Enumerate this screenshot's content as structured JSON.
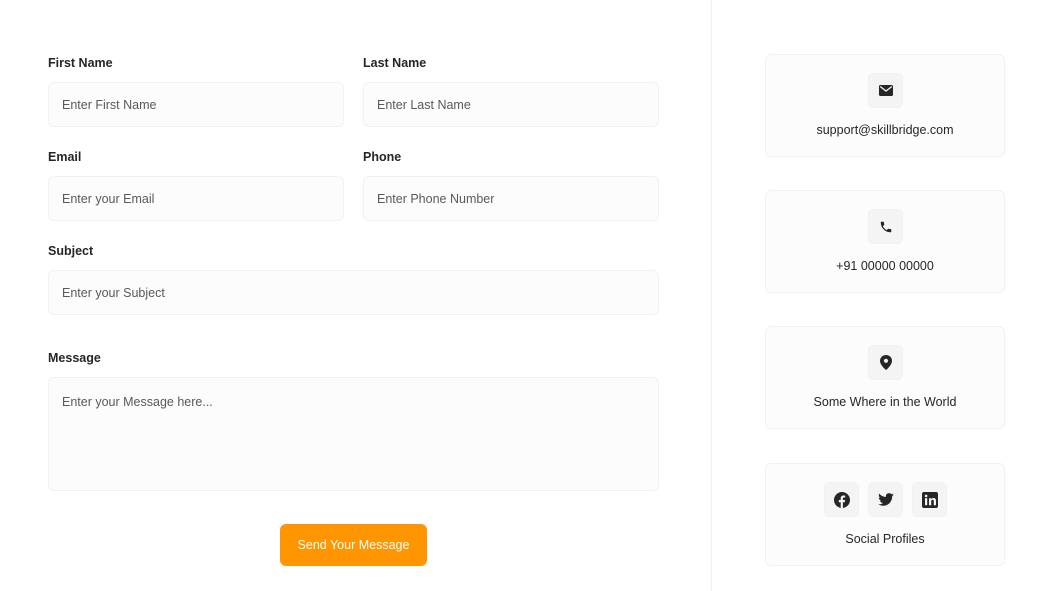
{
  "form": {
    "first_name": {
      "label": "First Name",
      "placeholder": "Enter First Name"
    },
    "last_name": {
      "label": "Last Name",
      "placeholder": "Enter Last Name"
    },
    "email": {
      "label": "Email",
      "placeholder": "Enter your Email"
    },
    "phone": {
      "label": "Phone",
      "placeholder": "Enter Phone Number"
    },
    "subject": {
      "label": "Subject",
      "placeholder": "Enter your Subject"
    },
    "message": {
      "label": "Message",
      "placeholder": "Enter your Message here..."
    },
    "submit_label": "Send Your Message"
  },
  "contact_cards": {
    "email": {
      "icon": "mail-icon",
      "text": "support@skillbridge.com"
    },
    "phone": {
      "icon": "phone-icon",
      "text": "+91 00000 00000"
    },
    "location": {
      "icon": "location-pin-icon",
      "text": "Some Where in the World"
    },
    "social": {
      "text": "Social Profiles",
      "icons": [
        "facebook-icon",
        "twitter-icon",
        "linkedin-icon"
      ]
    }
  },
  "colors": {
    "accent": "#ff9500",
    "field_bg": "#fcfcfd",
    "border": "#f1f1f3",
    "icon_bg": "#f4f4f5",
    "text": "#262626"
  }
}
